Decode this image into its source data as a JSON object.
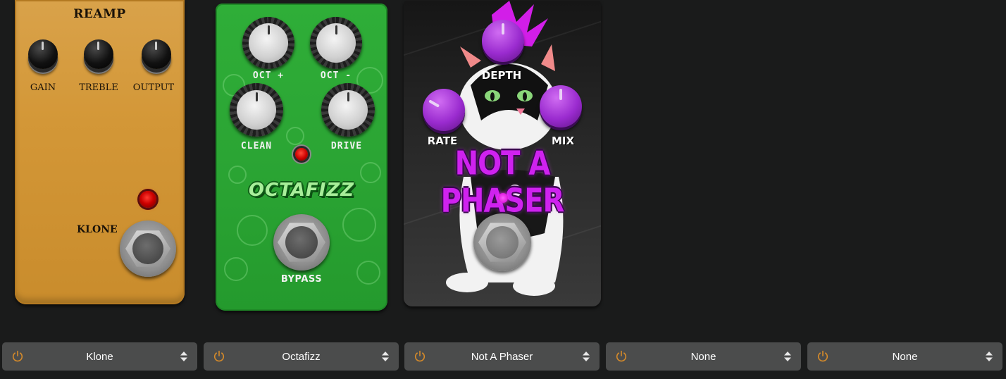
{
  "pedals": {
    "klone": {
      "title": "REAMP",
      "knobs": [
        "GAIN",
        "TREBLE",
        "OUTPUT"
      ],
      "brand": "KLONE",
      "color": "#d39737"
    },
    "octafizz": {
      "knobs": [
        "OCT +",
        "OCT -",
        "CLEAN",
        "DRIVE"
      ],
      "brand": "OCTAFIZZ",
      "switch_label": "BYPASS",
      "color": "#2ba534"
    },
    "phaser": {
      "knobs": [
        "DEPTH",
        "RATE",
        "MIX"
      ],
      "brand": "NOT A PHASER",
      "color": "#cf22ef"
    }
  },
  "slots": [
    {
      "name": "Klone",
      "power_icon": "power-icon",
      "arrows_icon": "updown-arrows-icon"
    },
    {
      "name": "Octafizz",
      "power_icon": "power-icon",
      "arrows_icon": "updown-arrows-icon"
    },
    {
      "name": "Not A Phaser",
      "power_icon": "power-icon",
      "arrows_icon": "updown-arrows-icon"
    },
    {
      "name": "None",
      "power_icon": "power-icon",
      "arrows_icon": "updown-arrows-icon"
    },
    {
      "name": "None",
      "power_icon": "power-icon",
      "arrows_icon": "updown-arrows-icon"
    }
  ],
  "colors": {
    "background": "#1a1b1b",
    "slot_bg": "#4b4c4c",
    "power_accent": "#d58a2a"
  }
}
